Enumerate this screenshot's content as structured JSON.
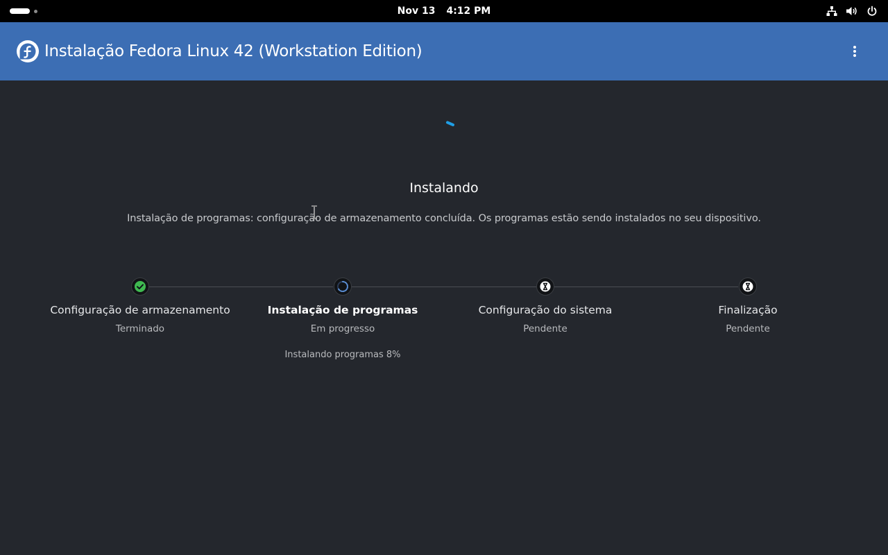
{
  "topbar": {
    "date": "Nov 13",
    "time": "4:12 PM",
    "tray_icons": [
      "network-icon",
      "volume-icon",
      "power-icon"
    ]
  },
  "header": {
    "title": "Instalação Fedora Linux 42 (Workstation Edition)",
    "logo_icon": "fedora-logo-icon",
    "menu_icon": "kebab-menu-icon",
    "background": "#3c6eb4"
  },
  "main": {
    "heading": "Instalando",
    "description": "Instalação de programas: configuração de armazenamento concluída. Os programas estão sendo instalados no seu dispositivo."
  },
  "steps": [
    {
      "title": "Configuração de armazenamento",
      "status": "Terminado",
      "state": "done",
      "icon": "checkmark-icon"
    },
    {
      "title": "Instalação de programas",
      "status": "Em progresso",
      "state": "in-progress",
      "icon": "spinner-icon",
      "detail": "Instalando programas 8%",
      "progress_percent": 8
    },
    {
      "title": "Configuração do sistema",
      "status": "Pendente",
      "state": "pending",
      "icon": "hourglass-icon"
    },
    {
      "title": "Finalização",
      "status": "Pendente",
      "state": "pending",
      "icon": "hourglass-icon"
    }
  ],
  "colors": {
    "background": "#24272d",
    "accent": "#3c6eb4",
    "done": "#3fb950",
    "spinner": "#1f9ee5"
  }
}
